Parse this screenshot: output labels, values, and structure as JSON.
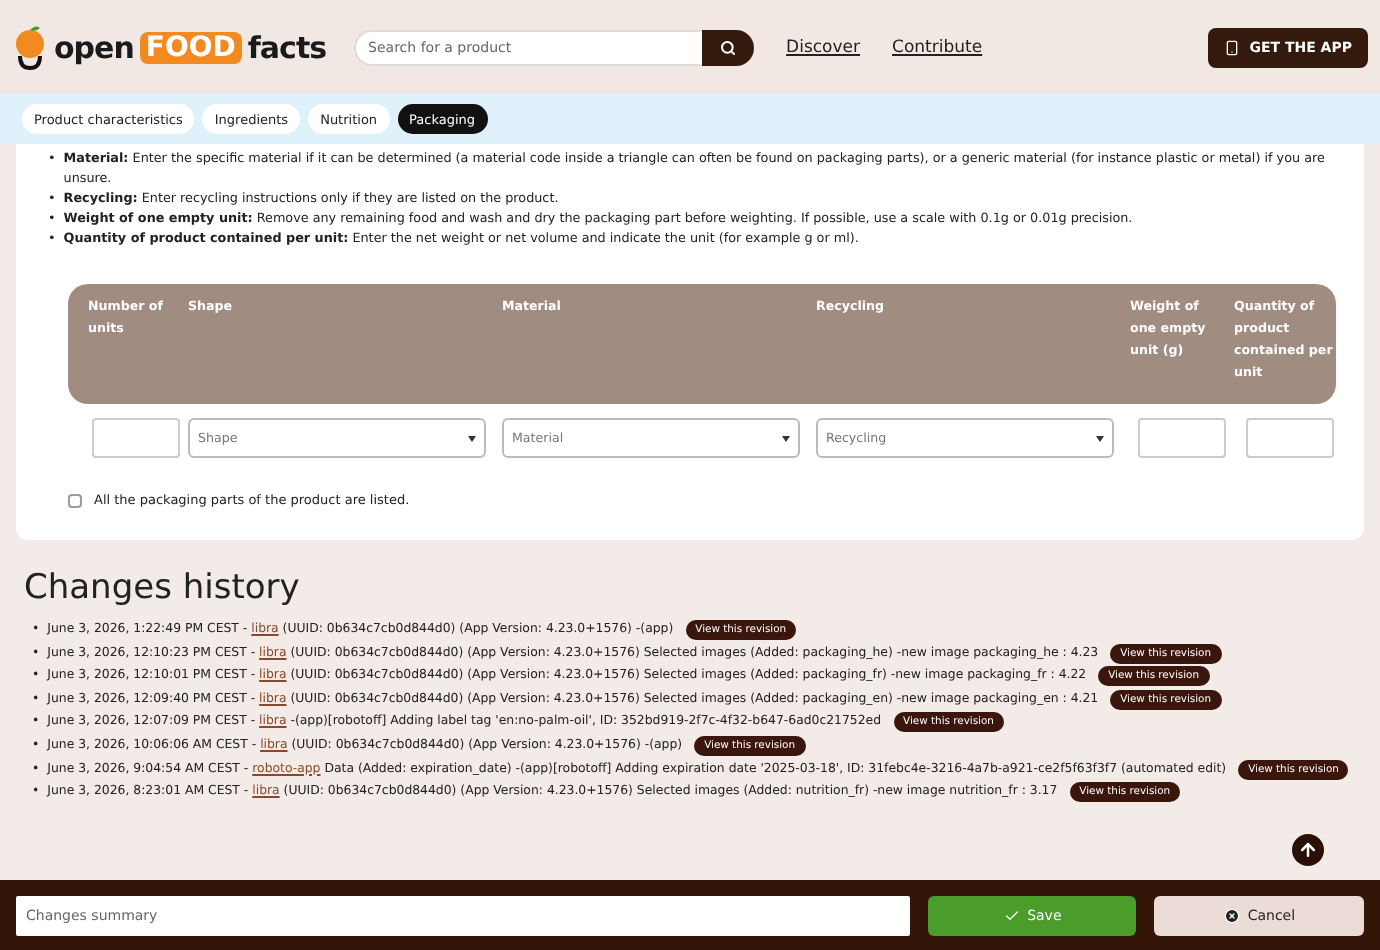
{
  "header": {
    "logo": {
      "part1": "open",
      "part2": "FOOD",
      "part3": "facts"
    },
    "search": {
      "placeholder": "Search for a product"
    },
    "links": [
      "Discover",
      "Contribute"
    ],
    "app_button": "GET THE APP"
  },
  "tabs": [
    {
      "label": "Product characteristics",
      "selected": false
    },
    {
      "label": "Ingredients",
      "selected": false
    },
    {
      "label": "Nutrition",
      "selected": false
    },
    {
      "label": "Packaging",
      "selected": true
    }
  ],
  "instructions": [
    {
      "marker": "•",
      "text": "**Material:** Enter the specific material if it can be determined (a material code inside a triangle can often be found on packaging parts), or a generic material (for instance plastic or metal) if you are unsure."
    },
    {
      "marker": "•",
      "text": "**Recycling:** Enter recycling instructions only if they are listed on the product."
    },
    {
      "marker": "•",
      "text": "**Weight of one empty unit:** Remove any remaining food and wash and dry the packaging part before weighting. If possible, use a scale with 0.1g or 0.01g precision."
    },
    {
      "marker": "•",
      "text": "**Quantity of product contained per unit:** Enter the net weight or net volume and indicate the unit (for example g or ml)."
    }
  ],
  "packaging_table": {
    "columns": [
      "Number of units",
      "Shape",
      "Material",
      "Recycling",
      "Weight of one empty unit (g)",
      "Quantity of product contained per unit"
    ],
    "row": [
      {
        "kind": "input"
      },
      {
        "kind": "select",
        "placeholder": "Shape"
      },
      {
        "kind": "select",
        "placeholder": "Material"
      },
      {
        "kind": "select",
        "placeholder": "Recycling"
      },
      {
        "kind": "input"
      },
      {
        "kind": "input"
      }
    ]
  },
  "all_parts_listed": {
    "label": "All the packaging parts of the product are listed.",
    "checked": false
  },
  "history": {
    "title": "Changes history",
    "entries": [
      {
        "marker": "•",
        "date": "June 3, 2026, 1:22:49 PM CEST -",
        "user": "libra",
        "details": "(UUID: 0b634c7cb0d844d0) (App Version: 4.23.0+1576) -(app)",
        "button": "View this revision"
      },
      {
        "marker": "•",
        "date": "June 3, 2026, 12:10:23 PM CEST -",
        "user": "libra",
        "details": "(UUID: 0b634c7cb0d844d0) (App Version: 4.23.0+1576) Selected images (Added: packaging_he) -new image packaging_he : 4.23",
        "button": "View this revision"
      },
      {
        "marker": "•",
        "date": "June 3, 2026, 12:10:01 PM CEST -",
        "user": "libra",
        "details": "(UUID: 0b634c7cb0d844d0) (App Version: 4.23.0+1576) Selected images (Added: packaging_fr) -new image packaging_fr : 4.22",
        "button": "View this revision"
      },
      {
        "marker": "•",
        "date": "June 3, 2026, 12:09:40 PM CEST -",
        "user": "libra",
        "details": "(UUID: 0b634c7cb0d844d0) (App Version: 4.23.0+1576) Selected images (Added: packaging_en) -new image packaging_en : 4.21",
        "button": "View this revision"
      },
      {
        "marker": "•",
        "date": "June 3, 2026, 12:07:09 PM CEST -",
        "user": "libra",
        "details": "-(app)[robotoff] Adding label tag 'en:no-palm-oil', ID: 352bd919-2f7c-4f32-b647-6ad0c21752ed",
        "button": "View this revision"
      },
      {
        "marker": "•",
        "date": "June 3, 2026, 10:06:06 AM CEST -",
        "user": "libra",
        "details": "(UUID: 0b634c7cb0d844d0) (App Version: 4.23.0+1576) -(app)",
        "button": "View this revision"
      },
      {
        "marker": "•",
        "date": "June 3, 2026, 9:04:54 AM CEST -",
        "user": "roboto-app",
        "details": "Data (Added: expiration_date) -(app)[robotoff] Adding expiration date '2025-03-18', ID: 31febc4e-3216-4a7b-a921-ce2f5f63f3f7 (automated edit)",
        "button": "View this revision"
      },
      {
        "marker": "•",
        "date": "June 3, 2026, 8:23:01 AM CEST -",
        "user": "libra",
        "details": "(UUID: 0b634c7cb0d844d0) (App Version: 4.23.0+1576) Selected images (Added: nutrition_fr) -new image nutrition_fr : 3.17",
        "button": "View this revision"
      }
    ]
  },
  "footer": {
    "summary": {
      "placeholder": "Changes summary"
    },
    "save": "Save",
    "cancel": "Cancel"
  }
}
